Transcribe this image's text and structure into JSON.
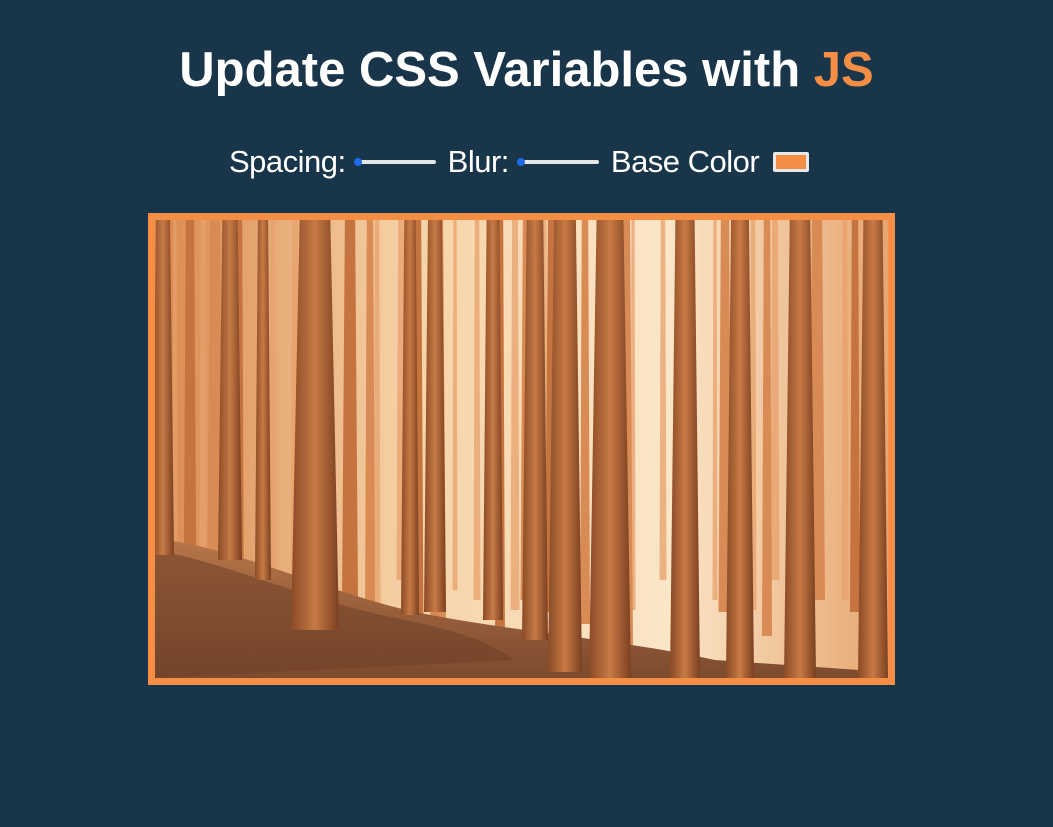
{
  "heading": {
    "text": "Update CSS Variables with",
    "accent": "JS"
  },
  "controls": {
    "spacing": {
      "label": "Spacing:",
      "value": 10
    },
    "blur": {
      "label": "Blur:",
      "value": 0
    },
    "base_color": {
      "label": "Base Color",
      "value": "#F38E44"
    }
  },
  "colors": {
    "background": "#193549",
    "accent": "#F38E44",
    "slider_thumb": "#1E6BE6"
  },
  "image": {
    "subject": "sunlit pine forest with a dirt path"
  }
}
